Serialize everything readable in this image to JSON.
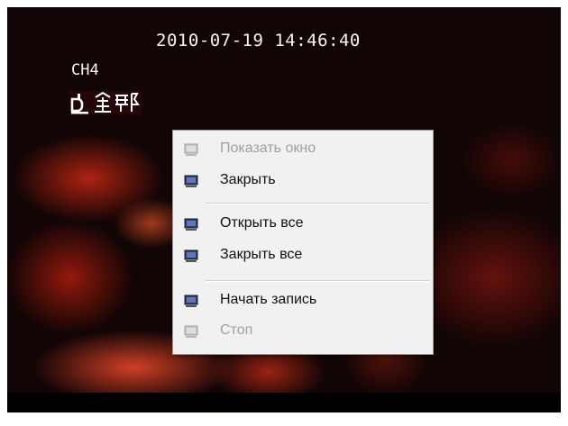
{
  "video": {
    "timestamp": "2010-07-19 14:46:40",
    "channel": "CH4",
    "record_badge_icon": "record-all-icon"
  },
  "context_menu": {
    "items": [
      {
        "label": "Показать окно",
        "enabled": false,
        "icon": "monitor-icon"
      },
      {
        "label": "Закрыть",
        "enabled": true,
        "icon": "monitor-icon"
      },
      {
        "label": "Открыть все",
        "enabled": true,
        "icon": "monitor-icon"
      },
      {
        "label": "Закрыть все",
        "enabled": true,
        "icon": "monitor-icon"
      },
      {
        "label": "Начать запись",
        "enabled": true,
        "icon": "monitor-icon"
      },
      {
        "label": "Стоп",
        "enabled": false,
        "icon": "monitor-icon"
      }
    ]
  },
  "colors": {
    "menu_background": "#f1f1f1",
    "disabled_text": "#a0a0a0",
    "overlay_text": "#f4f4f4"
  }
}
